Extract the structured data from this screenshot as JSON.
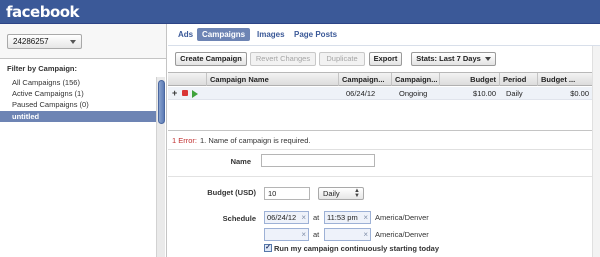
{
  "app": {
    "logo_text": "facebook"
  },
  "sidebar": {
    "account_id": "24286257",
    "filter_label": "Filter by Campaign:",
    "items": [
      {
        "label": "All Campaigns (156)",
        "selected": false
      },
      {
        "label": "Active Campaigns (1)",
        "selected": false
      },
      {
        "label": "Paused Campaigns (0)",
        "selected": false
      },
      {
        "label": "untitled",
        "selected": true
      }
    ]
  },
  "tabs": [
    {
      "label": "Ads",
      "active": false
    },
    {
      "label": "Campaigns",
      "active": true
    },
    {
      "label": "Images",
      "active": false
    },
    {
      "label": "Page Posts",
      "active": false
    }
  ],
  "toolbar": {
    "create_label": "Create Campaign",
    "revert_label": "Revert Changes",
    "duplicate_label": "Duplicate",
    "export_label": "Export",
    "stats_label": "Stats: Last 7 Days"
  },
  "table": {
    "headers": [
      "Campaign Name",
      "Campaign...",
      "Campaign...",
      "Budget",
      "Period",
      "Budget ..."
    ],
    "rows": [
      {
        "name": "",
        "start_date": "06/24/12",
        "status": "Ongoing",
        "budget": "$10.00",
        "period": "Daily",
        "budget_remaining": "$0.00"
      }
    ]
  },
  "error": {
    "count_label": "1 Error:",
    "message": "1. Name of campaign is required."
  },
  "form": {
    "name_label": "Name",
    "name_value": "",
    "budget_label": "Budget (USD)",
    "budget_value": "10",
    "period_value": "Daily",
    "schedule_label": "Schedule",
    "start_date": "06/24/12",
    "at_label": "at",
    "start_time": "11:53 pm",
    "timezone": "America/Denver",
    "end_date": "",
    "end_time": "",
    "continuous_label": "Run my campaign continuously starting today",
    "continuous_checked": true
  },
  "colors": {
    "brand": "#3b5998",
    "selected": "#6d84b4",
    "error": "#c03030",
    "active_status": "#3fa33a"
  }
}
